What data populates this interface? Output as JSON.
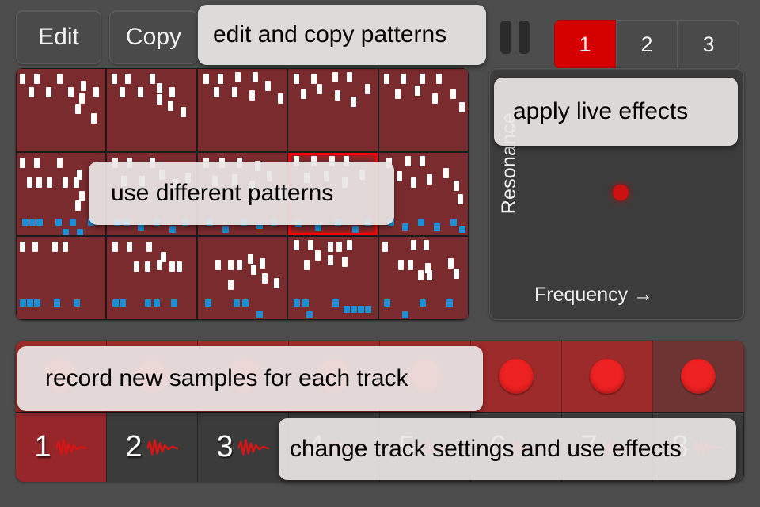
{
  "toolbar": {
    "edit_label": "Edit",
    "copy_label": "Copy",
    "pause_icon": "pause-icon",
    "banks": [
      {
        "label": "1",
        "active": true
      },
      {
        "label": "2",
        "active": false
      },
      {
        "label": "3",
        "active": false
      }
    ]
  },
  "colors": {
    "background": "#4d4d4d",
    "pattern_cell": "#7a2b2e",
    "note_white": "#ffffff",
    "note_blue": "#1e8fd5",
    "accent_red": "#d50000",
    "record_red": "#ee2222",
    "tooltip_bg": "#e9e7e6"
  },
  "pattern_grid": {
    "rows": 3,
    "columns": 5,
    "selected_cell": {
      "row": 1,
      "col": 3
    },
    "cells": [
      {
        "row": 0,
        "col": 0,
        "selected": false,
        "notes": [
          [
            4,
            6
          ],
          [
            20,
            6
          ],
          [
            45,
            6
          ],
          [
            13,
            22
          ],
          [
            33,
            22
          ],
          [
            58,
            22
          ],
          [
            72,
            14
          ],
          [
            70,
            30
          ],
          [
            86,
            22
          ],
          [
            66,
            42
          ],
          [
            84,
            54
          ]
        ],
        "blue_notes": []
      },
      {
        "row": 0,
        "col": 1,
        "selected": false,
        "notes": [
          [
            5,
            6
          ],
          [
            20,
            6
          ],
          [
            48,
            6
          ],
          [
            14,
            22
          ],
          [
            34,
            22
          ],
          [
            56,
            17
          ],
          [
            56,
            31
          ],
          [
            70,
            22
          ],
          [
            68,
            38
          ],
          [
            82,
            46
          ]
        ],
        "blue_notes": []
      },
      {
        "row": 0,
        "col": 2,
        "selected": false,
        "notes": [
          [
            6,
            6
          ],
          [
            22,
            6
          ],
          [
            42,
            4
          ],
          [
            62,
            4
          ],
          [
            18,
            22
          ],
          [
            38,
            22
          ],
          [
            58,
            26
          ],
          [
            76,
            14
          ],
          [
            90,
            30
          ]
        ],
        "blue_notes": []
      },
      {
        "row": 0,
        "col": 3,
        "selected": false,
        "notes": [
          [
            6,
            6
          ],
          [
            26,
            6
          ],
          [
            50,
            4
          ],
          [
            66,
            4
          ],
          [
            14,
            24
          ],
          [
            32,
            18
          ],
          [
            52,
            26
          ],
          [
            70,
            34
          ],
          [
            86,
            18
          ]
        ],
        "blue_notes": []
      },
      {
        "row": 0,
        "col": 4,
        "selected": false,
        "notes": [
          [
            6,
            6
          ],
          [
            24,
            6
          ],
          [
            46,
            6
          ],
          [
            64,
            6
          ],
          [
            18,
            24
          ],
          [
            40,
            20
          ],
          [
            60,
            30
          ],
          [
            80,
            24
          ],
          [
            90,
            40
          ]
        ],
        "blue_notes": []
      },
      {
        "row": 1,
        "col": 0,
        "selected": false,
        "notes": [
          [
            4,
            6
          ],
          [
            20,
            6
          ],
          [
            45,
            6
          ],
          [
            68,
            20
          ],
          [
            12,
            30
          ],
          [
            22,
            30
          ],
          [
            34,
            30
          ],
          [
            52,
            30
          ],
          [
            64,
            30
          ],
          [
            70,
            46
          ],
          [
            66,
            58
          ]
        ],
        "blue_notes": [
          [
            6,
            80
          ],
          [
            14,
            80
          ],
          [
            22,
            80
          ],
          [
            44,
            80
          ],
          [
            60,
            80
          ],
          [
            52,
            92
          ],
          [
            68,
            92
          ],
          [
            80,
            80
          ]
        ]
      },
      {
        "row": 1,
        "col": 1,
        "selected": false,
        "notes": [
          [
            6,
            6
          ],
          [
            22,
            6
          ],
          [
            48,
            6
          ],
          [
            16,
            28
          ],
          [
            36,
            28
          ],
          [
            58,
            20
          ],
          [
            74,
            32
          ],
          [
            88,
            24
          ]
        ],
        "blue_notes": [
          [
            8,
            80
          ],
          [
            18,
            80
          ],
          [
            34,
            86
          ],
          [
            52,
            80
          ],
          [
            70,
            88
          ],
          [
            84,
            80
          ]
        ]
      },
      {
        "row": 1,
        "col": 2,
        "selected": false,
        "notes": [
          [
            6,
            6
          ],
          [
            24,
            6
          ],
          [
            44,
            6
          ],
          [
            64,
            10
          ],
          [
            16,
            28
          ],
          [
            38,
            26
          ],
          [
            58,
            34
          ],
          [
            78,
            22
          ],
          [
            88,
            42
          ]
        ],
        "blue_notes": [
          [
            10,
            80
          ],
          [
            28,
            88
          ],
          [
            48,
            80
          ],
          [
            66,
            84
          ],
          [
            82,
            80
          ]
        ]
      },
      {
        "row": 1,
        "col": 3,
        "selected": true,
        "notes": [
          [
            6,
            4
          ],
          [
            26,
            4
          ],
          [
            46,
            4
          ],
          [
            62,
            4
          ],
          [
            18,
            24
          ],
          [
            40,
            22
          ],
          [
            60,
            30
          ],
          [
            80,
            20
          ]
        ],
        "blue_notes": [
          [
            8,
            82
          ],
          [
            30,
            86
          ],
          [
            52,
            80
          ],
          [
            72,
            88
          ],
          [
            86,
            80
          ]
        ]
      },
      {
        "row": 1,
        "col": 4,
        "selected": false,
        "notes": [
          [
            8,
            6
          ],
          [
            30,
            4
          ],
          [
            46,
            4
          ],
          [
            20,
            22
          ],
          [
            36,
            30
          ],
          [
            54,
            26
          ],
          [
            72,
            18
          ],
          [
            84,
            34
          ],
          [
            88,
            50
          ]
        ],
        "blue_notes": [
          [
            10,
            80
          ],
          [
            26,
            86
          ],
          [
            44,
            80
          ],
          [
            62,
            86
          ],
          [
            80,
            80
          ],
          [
            90,
            88
          ]
        ]
      },
      {
        "row": 2,
        "col": 0,
        "selected": false,
        "notes": [
          [
            4,
            6
          ],
          [
            18,
            6
          ],
          [
            40,
            6
          ],
          [
            52,
            6
          ]
        ],
        "blue_notes": [
          [
            4,
            76
          ],
          [
            12,
            76
          ],
          [
            20,
            76
          ],
          [
            42,
            76
          ],
          [
            64,
            76
          ]
        ]
      },
      {
        "row": 2,
        "col": 1,
        "selected": false,
        "notes": [
          [
            6,
            6
          ],
          [
            22,
            6
          ],
          [
            44,
            6
          ],
          [
            60,
            18
          ],
          [
            30,
            30
          ],
          [
            42,
            30
          ],
          [
            56,
            28
          ],
          [
            70,
            30
          ],
          [
            78,
            30
          ]
        ],
        "blue_notes": [
          [
            6,
            76
          ],
          [
            14,
            76
          ],
          [
            42,
            76
          ],
          [
            52,
            76
          ],
          [
            72,
            76
          ]
        ]
      },
      {
        "row": 2,
        "col": 2,
        "selected": false,
        "notes": [
          [
            20,
            28
          ],
          [
            34,
            28
          ],
          [
            44,
            28
          ],
          [
            56,
            20
          ],
          [
            60,
            34
          ],
          [
            70,
            26
          ],
          [
            72,
            44
          ],
          [
            86,
            50
          ],
          [
            34,
            52
          ]
        ],
        "blue_notes": [
          [
            8,
            76
          ],
          [
            40,
            76
          ],
          [
            50,
            76
          ],
          [
            66,
            90
          ]
        ]
      },
      {
        "row": 2,
        "col": 3,
        "selected": false,
        "notes": [
          [
            6,
            4
          ],
          [
            22,
            4
          ],
          [
            44,
            6
          ],
          [
            54,
            6
          ],
          [
            66,
            4
          ],
          [
            30,
            16
          ],
          [
            44,
            22
          ],
          [
            18,
            28
          ],
          [
            60,
            24
          ]
        ],
        "blue_notes": [
          [
            6,
            76
          ],
          [
            16,
            76
          ],
          [
            20,
            90
          ],
          [
            50,
            76
          ],
          [
            62,
            84
          ],
          [
            70,
            84
          ],
          [
            78,
            84
          ],
          [
            86,
            84
          ]
        ]
      },
      {
        "row": 2,
        "col": 4,
        "selected": false,
        "notes": [
          [
            4,
            6
          ],
          [
            36,
            4
          ],
          [
            50,
            4
          ],
          [
            22,
            28
          ],
          [
            32,
            28
          ],
          [
            52,
            32
          ],
          [
            44,
            40
          ],
          [
            54,
            40
          ],
          [
            78,
            26
          ],
          [
            84,
            38
          ]
        ],
        "blue_notes": [
          [
            6,
            76
          ],
          [
            26,
            90
          ],
          [
            46,
            76
          ],
          [
            76,
            76
          ]
        ]
      }
    ]
  },
  "effect_pad": {
    "y_axis_label": "Resonance",
    "y_axis_arrow": "↑",
    "x_axis_label": "Frequency →",
    "dot_name": "xy-control-dot"
  },
  "record_row": {
    "cells": [
      {
        "dim": false
      },
      {
        "dim": false
      },
      {
        "dim": false
      },
      {
        "dim": false
      },
      {
        "dim": false
      },
      {
        "dim": false
      },
      {
        "dim": false
      },
      {
        "dim": true
      }
    ]
  },
  "track_row": {
    "tracks": [
      {
        "label": "1",
        "active": true
      },
      {
        "label": "2",
        "active": false
      },
      {
        "label": "3",
        "active": false
      },
      {
        "label": "4",
        "active": false
      },
      {
        "label": "5",
        "active": false
      },
      {
        "label": "6",
        "active": false
      },
      {
        "label": "7",
        "active": false
      },
      {
        "label": "8",
        "active": false
      }
    ]
  },
  "tooltips": {
    "edit_copy": "edit and copy patterns",
    "live_effects": "apply live effects",
    "patterns": "use different patterns",
    "record": "record new samples for each track",
    "track_settings": "change track settings and use effects"
  }
}
